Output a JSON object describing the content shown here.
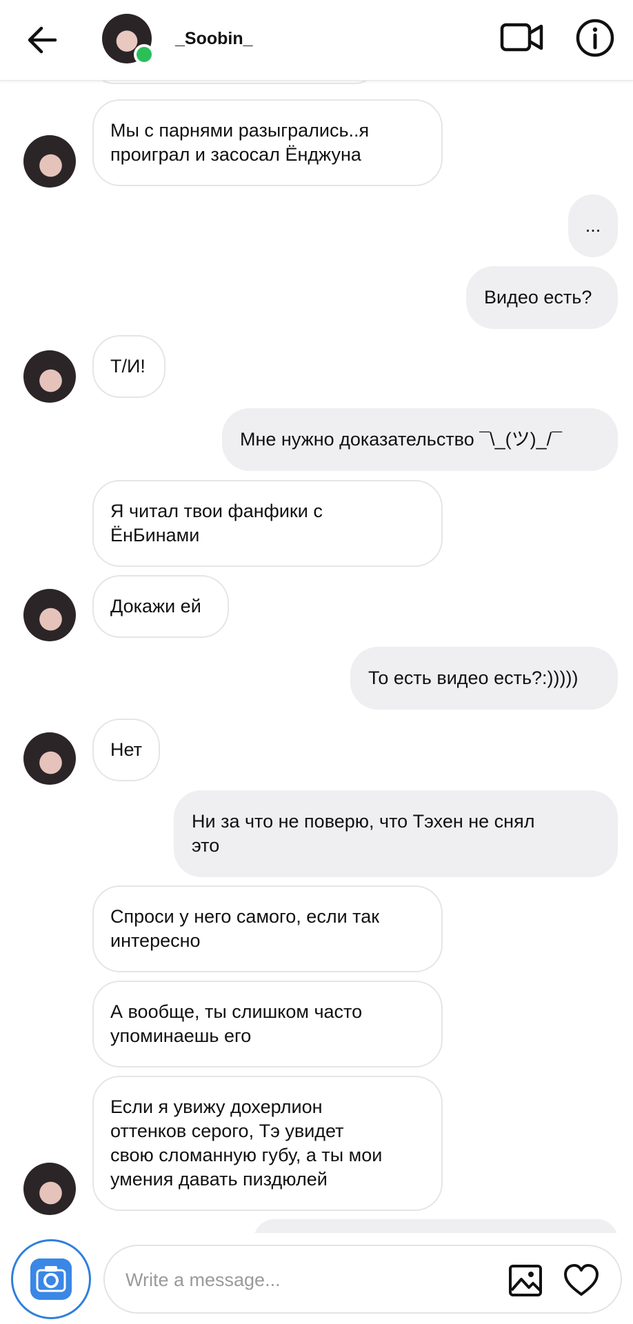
{
  "header": {
    "title": "_Soobin_",
    "icons": {
      "back": "arrow-left-icon",
      "video": "video-call-icon",
      "info": "info-icon"
    }
  },
  "messages": [
    {
      "side": "in",
      "text": "Мы с парнями разыгрались..я\nпроиграл и засосал Ёнджуна",
      "avatar": true
    },
    {
      "side": "out",
      "text": "..."
    },
    {
      "side": "out",
      "text": "Видео есть?"
    },
    {
      "side": "in",
      "text": "Т/И!",
      "avatar": true
    },
    {
      "side": "out",
      "text": "Мне нужно доказательство ¯\\_(ツ)_/¯"
    },
    {
      "side": "in",
      "text": "Я читал твои фанфики с\nЁнБинами",
      "avatar": false
    },
    {
      "side": "in",
      "text": "Докажи ей",
      "avatar": true
    },
    {
      "side": "out",
      "text": "То есть видео есть?:)))))"
    },
    {
      "side": "in",
      "text": "Нет",
      "avatar": true
    },
    {
      "side": "out",
      "text": "Ни за что не поверю, что Тэхен не снял\nэто"
    },
    {
      "side": "in",
      "text": "Спроси у него самого, если так\nинтересно",
      "avatar": false
    },
    {
      "side": "in",
      "text": "А вообще, ты слишком часто\nупоминаешь его",
      "avatar": false
    },
    {
      "side": "in",
      "text": "Если я увижу дохерлион\nоттенков серого, Тэ увидет\nсвою сломанную губу, а ты мои\nумения давать пиздюлей",
      "avatar": true
    }
  ],
  "composer": {
    "placeholder": "Write a message...",
    "icons": {
      "camera": "camera-icon",
      "gallery": "gallery-icon",
      "like": "heart-icon"
    },
    "accent_color": "#3a87e6"
  },
  "status": {
    "online_color": "#2bbf5a"
  }
}
